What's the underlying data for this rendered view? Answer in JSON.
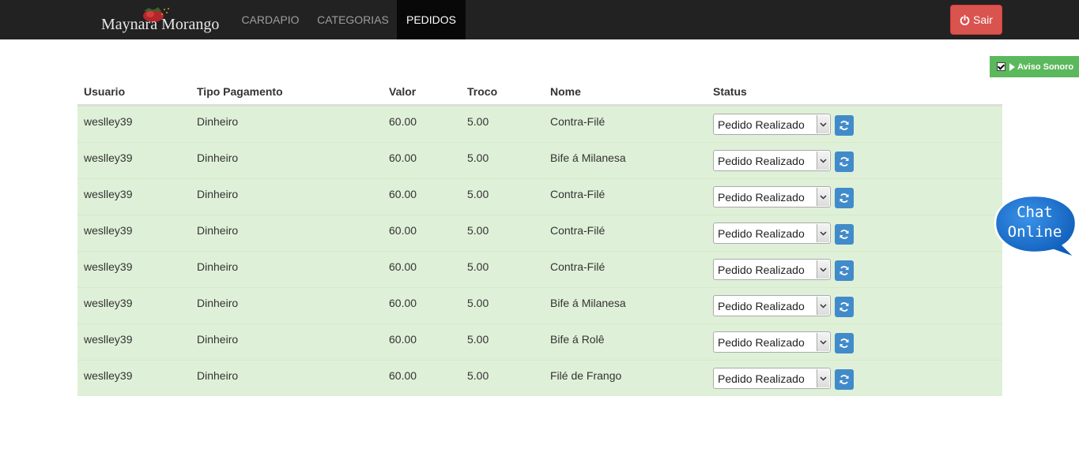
{
  "navbar": {
    "brand": "Maynara Morango",
    "items": [
      {
        "label": "CARDAPIO",
        "active": false
      },
      {
        "label": "CATEGORIAS",
        "active": false
      },
      {
        "label": "PEDIDOS",
        "active": true
      }
    ],
    "logout_label": "Sair",
    "logout_icon": "power-icon",
    "logout_color": "#d9534f"
  },
  "aviso": {
    "label": "Aviso Sonoro",
    "checked": true,
    "color": "#5cb85c"
  },
  "table": {
    "headers": [
      "Usuario",
      "Tipo Pagamento",
      "Valor",
      "Troco",
      "Nome",
      "Status"
    ],
    "rows": [
      {
        "usuario": "weslley39",
        "tipo": "Dinheiro",
        "valor": "60.00",
        "troco": "5.00",
        "nome": "Contra-Filé",
        "status": "Pedido Realizado"
      },
      {
        "usuario": "weslley39",
        "tipo": "Dinheiro",
        "valor": "60.00",
        "troco": "5.00",
        "nome": "Bife á Milanesa",
        "status": "Pedido Realizado"
      },
      {
        "usuario": "weslley39",
        "tipo": "Dinheiro",
        "valor": "60.00",
        "troco": "5.00",
        "nome": "Contra-Filé",
        "status": "Pedido Realizado"
      },
      {
        "usuario": "weslley39",
        "tipo": "Dinheiro",
        "valor": "60.00",
        "troco": "5.00",
        "nome": "Contra-Filé",
        "status": "Pedido Realizado"
      },
      {
        "usuario": "weslley39",
        "tipo": "Dinheiro",
        "valor": "60.00",
        "troco": "5.00",
        "nome": "Contra-Filé",
        "status": "Pedido Realizado"
      },
      {
        "usuario": "weslley39",
        "tipo": "Dinheiro",
        "valor": "60.00",
        "troco": "5.00",
        "nome": "Bife á Milanesa",
        "status": "Pedido Realizado"
      },
      {
        "usuario": "weslley39",
        "tipo": "Dinheiro",
        "valor": "60.00",
        "troco": "5.00",
        "nome": "Bife á Rolê",
        "status": "Pedido Realizado"
      },
      {
        "usuario": "weslley39",
        "tipo": "Dinheiro",
        "valor": "60.00",
        "troco": "5.00",
        "nome": "Filé de Frango",
        "status": "Pedido Realizado"
      }
    ],
    "row_color": "#dff0d8",
    "refresh_icon": "refresh-icon",
    "refresh_color": "#428bca"
  },
  "chat": {
    "line1": "Chat",
    "line2": "Online",
    "color": "#1a6fc9"
  }
}
